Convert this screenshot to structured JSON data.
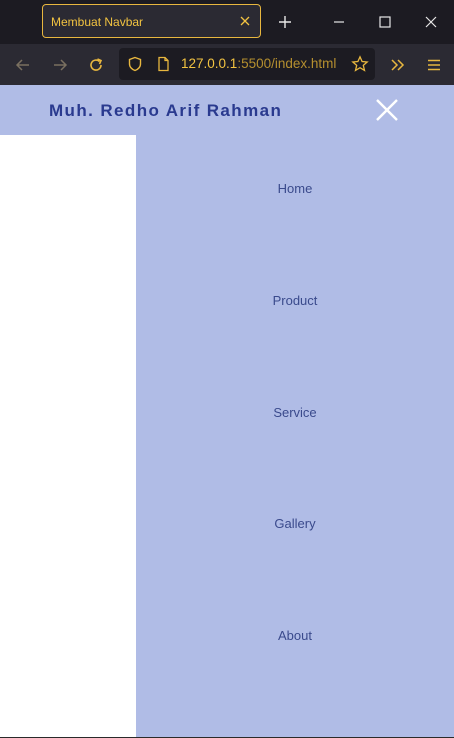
{
  "browser": {
    "tab_title": "Membuat Navbar",
    "url_host": "127.0.0.1",
    "url_path": ":5500/index.html"
  },
  "navbar": {
    "brand": "Muh. Redho Arif Rahman"
  },
  "menu": {
    "items": [
      {
        "label": "Home"
      },
      {
        "label": "Product"
      },
      {
        "label": "Service"
      },
      {
        "label": "Gallery"
      },
      {
        "label": "About"
      }
    ]
  },
  "colors": {
    "nav_bg": "#b0bce6",
    "brand_text": "#2a3a8f",
    "menu_text": "#3a4a8c",
    "accent": "#e8b73f"
  },
  "icons": {
    "tab_close": "close-icon",
    "new_tab": "plus-icon",
    "minimize": "minimize-icon",
    "maximize": "maximize-icon",
    "window_close": "close-icon",
    "back": "arrow-left-icon",
    "forward": "arrow-right-icon",
    "reload": "reload-icon",
    "shield": "shield-icon",
    "page": "page-icon",
    "bookmark": "star-icon",
    "extensions": "chevrons-right-icon",
    "menu": "hamburger-icon",
    "close_menu": "close-icon"
  }
}
